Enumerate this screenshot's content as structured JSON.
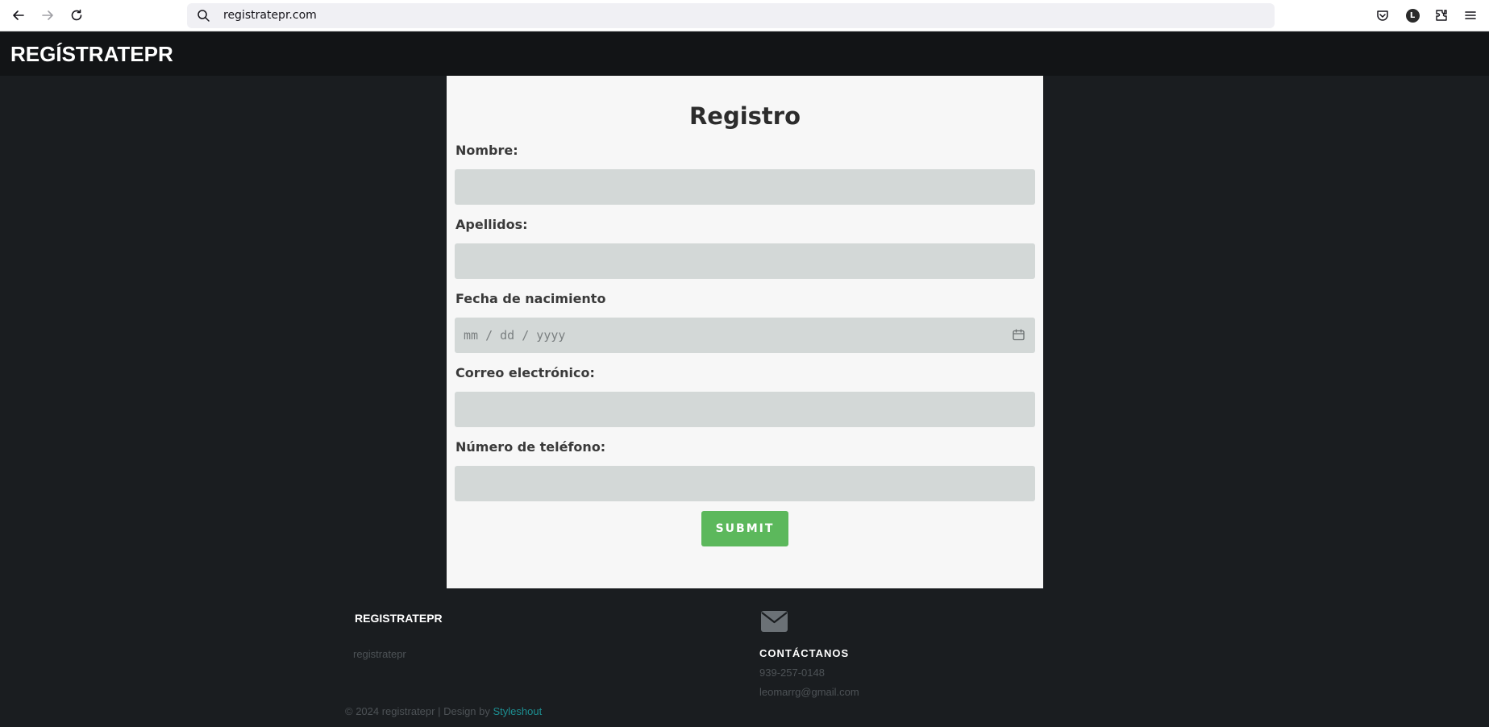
{
  "browser": {
    "url": "registratepr.com",
    "icons": [
      "back-icon",
      "forward-icon",
      "reload-icon",
      "search-icon",
      "pocket-icon",
      "account-icon",
      "extensions-icon",
      "menu-icon"
    ],
    "account_initial": "L"
  },
  "header": {
    "logo": "REGÍSTRATEPR"
  },
  "form": {
    "title": "Registro",
    "fields": [
      {
        "label": "Nombre:",
        "value": ""
      },
      {
        "label": "Apellidos:",
        "value": ""
      },
      {
        "label": "Fecha de nacimiento",
        "placeholder": "mm / dd / yyyy",
        "icon": "calendar-icon"
      },
      {
        "label": "Correo electrónico:",
        "value": ""
      },
      {
        "label": "Número de teléfono:",
        "value": ""
      }
    ],
    "submit_label": "SUBMIT"
  },
  "colors": {
    "header_bg": "#121416",
    "page_bg": "#1a1d20",
    "card_bg": "#f7f7f7",
    "input_bg": "#d3d8d7",
    "submit_bg": "#5cb85c",
    "link": "#1d8e91"
  },
  "footer": {
    "brand": "REGISTRATEPR",
    "description": "registratepr",
    "contact_icon": "mail-icon",
    "contact_title": "CONTÁCTANOS",
    "phone": "939-257-0148",
    "email": "leomarrg@gmail.com",
    "copyright_text": "© 2024 registratepr | Design by ",
    "design_link": "Styleshout"
  }
}
